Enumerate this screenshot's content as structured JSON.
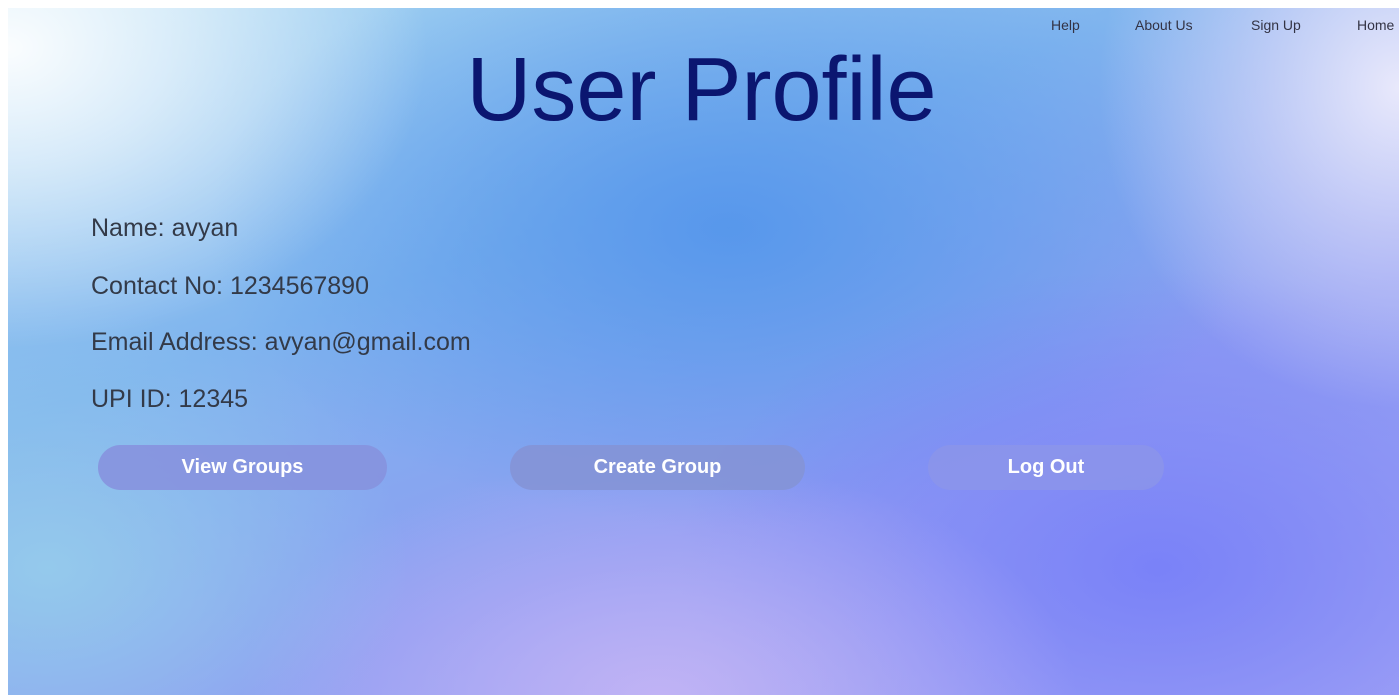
{
  "nav": {
    "items": [
      {
        "label": "Help"
      },
      {
        "label": "About Us"
      },
      {
        "label": "Sign Up"
      },
      {
        "label": "Home"
      }
    ]
  },
  "page": {
    "title": "User Profile"
  },
  "profile": {
    "name": "Name: avyan",
    "contact": "Contact No: 1234567890",
    "email": "Email Address: avyan@gmail.com",
    "upi": "UPI ID: 12345"
  },
  "actions": {
    "view_groups": "View Groups",
    "create_group": "Create Group",
    "log_out": "Log Out"
  },
  "colors": {
    "title": "#0b1670",
    "text": "#333a48",
    "button_text": "#ffffff"
  }
}
